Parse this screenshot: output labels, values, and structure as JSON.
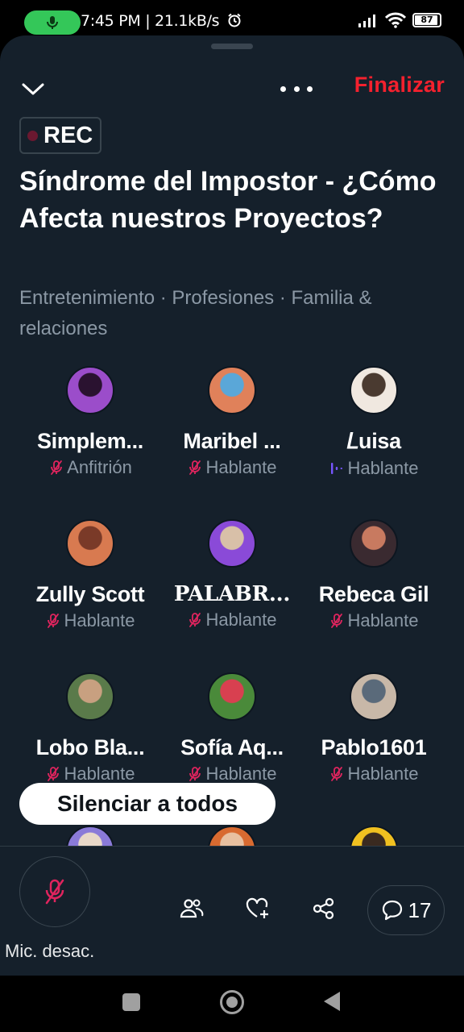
{
  "status_bar": {
    "text": "7:45 PM | 21.1kB/s",
    "battery": "87"
  },
  "header": {
    "end_label": "Finalizar",
    "rec_label": "REC"
  },
  "space": {
    "title": "Síndrome del Impostor - ¿Cómo Afecta nuestros Proyectos?",
    "topics": "Entretenimiento · Profesiones · Familia & relaciones"
  },
  "speakers": [
    {
      "name": "Simplem...",
      "role": "Anfitrión",
      "mic": "muted",
      "avatar_colors": [
        "#9b4dca",
        "#2a1230"
      ]
    },
    {
      "name": "Maribel ...",
      "role": "Hablante",
      "mic": "muted",
      "avatar_colors": [
        "#e0815a",
        "#5aa7d8"
      ]
    },
    {
      "name": "𝐿uisa",
      "role": "Hablante",
      "mic": "speaking",
      "avatar_colors": [
        "#f0e8e0",
        "#4a3a30"
      ]
    },
    {
      "name": "Zully Scott",
      "role": "Hablante",
      "mic": "muted",
      "avatar_colors": [
        "#d87a50",
        "#7a3a28"
      ]
    },
    {
      "name": "PALABR...",
      "role": "Hablante",
      "mic": "muted",
      "avatar_colors": [
        "#8a4ad8",
        "#d8c0a8"
      ]
    },
    {
      "name": "Rebeca Gil",
      "role": "Hablante",
      "mic": "muted",
      "avatar_colors": [
        "#3a2a30",
        "#c87a60"
      ]
    },
    {
      "name": "Lobo Bla...",
      "role": "Hablante",
      "mic": "muted",
      "avatar_colors": [
        "#5a7a4a",
        "#c8a080"
      ]
    },
    {
      "name": "Sofía Aq...",
      "role": "Hablante",
      "mic": "muted",
      "avatar_colors": [
        "#4a8a3a",
        "#d84050"
      ]
    },
    {
      "name": "Pablo1601",
      "role": "Hablante",
      "mic": "muted",
      "avatar_colors": [
        "#c8b8a8",
        "#5a6a7a"
      ]
    }
  ],
  "partial_avatars": [
    {
      "avatar_colors": [
        "#8a7ad8",
        "#e8d8c8"
      ]
    },
    {
      "avatar_colors": [
        "#d86a30",
        "#e8c0a0"
      ]
    },
    {
      "avatar_colors": [
        "#f0c020",
        "#3a2a20"
      ]
    }
  ],
  "mute_all_label": "Silenciar a todos",
  "bottom_bar": {
    "mic_label": "Mic. desac.",
    "comments_count": "17"
  },
  "colors": {
    "sheet_bg": "#15202b",
    "accent_red": "#f4212e",
    "muted_icon": "#e0245e",
    "speaking_icon": "#7856ff",
    "secondary_text": "#8b98a5"
  }
}
